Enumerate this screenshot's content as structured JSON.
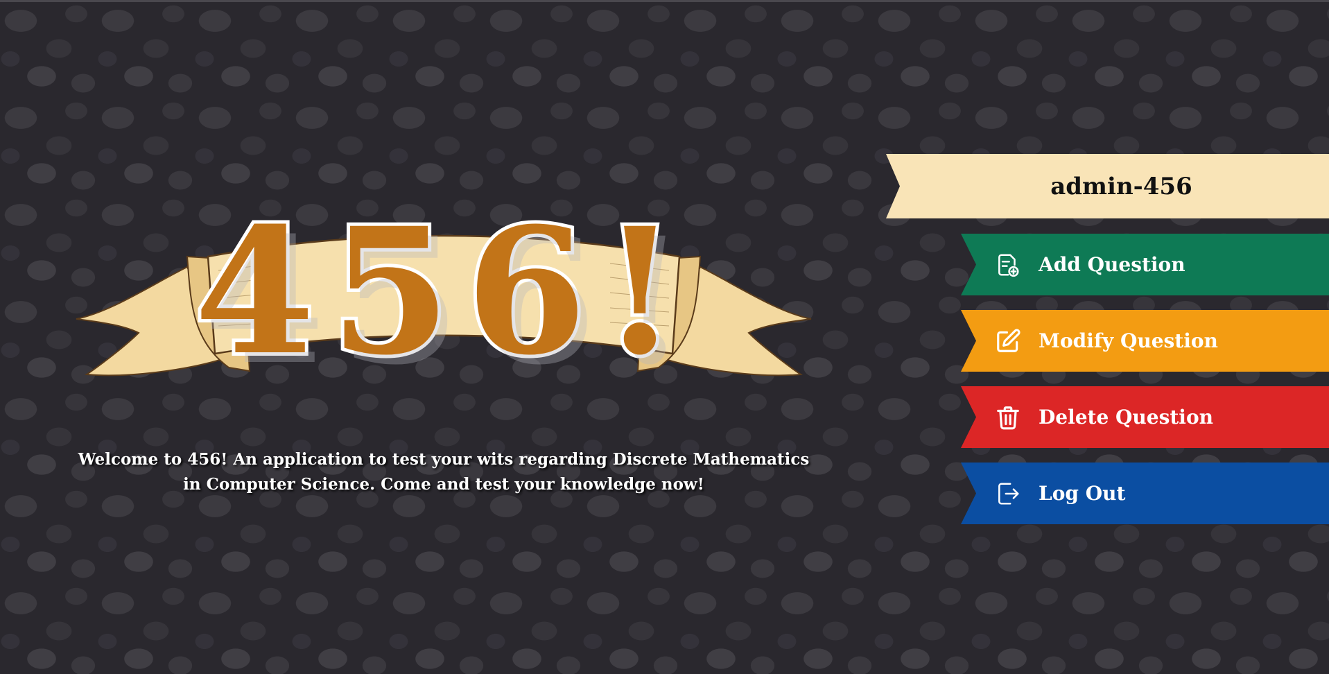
{
  "logo": {
    "text": "456!"
  },
  "welcome": {
    "text": "Welcome to 456! An application to test your wits regarding Discrete Mathematics in Computer Science. Come and test your knowledge now!"
  },
  "user": {
    "name": "admin-456"
  },
  "menu": {
    "add_label": "Add Question",
    "modify_label": "Modify Question",
    "delete_label": "Delete Question",
    "logout_label": "Log Out"
  },
  "colors": {
    "username_ribbon": "#f9e4b7",
    "add": "#0e7a55",
    "modify": "#f39c12",
    "delete": "#dc2626",
    "logout": "#0b4ea2",
    "logo_fill": "#c27418",
    "banner": "#f3d9a0"
  },
  "icons": {
    "add": "document-add-icon",
    "modify": "edit-icon",
    "delete": "trash-icon",
    "logout": "logout-icon"
  }
}
